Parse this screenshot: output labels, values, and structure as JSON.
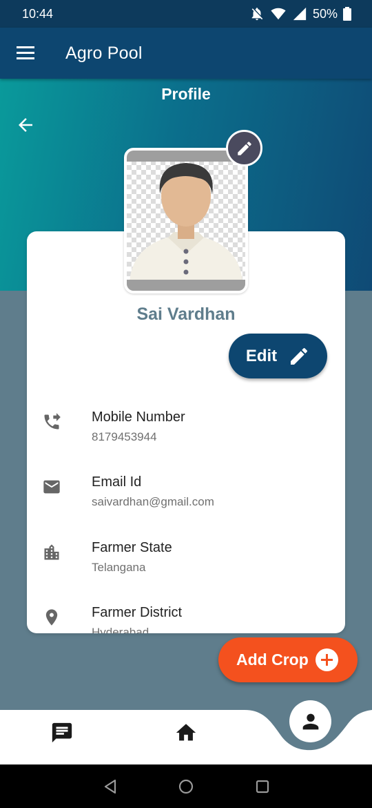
{
  "status_bar": {
    "time": "10:44",
    "battery": "50%"
  },
  "app_bar": {
    "title": "Agro Pool",
    "menu_icon": "menu-icon"
  },
  "page": {
    "title": "Profile"
  },
  "profile": {
    "name": "Sai Vardhan",
    "edit_label": "Edit",
    "fields": [
      {
        "icon": "phone-forward-icon",
        "label": "Mobile Number",
        "value": "8179453944"
      },
      {
        "icon": "email-icon",
        "label": "Email Id",
        "value": "saivardhan@gmail.com"
      },
      {
        "icon": "building-icon",
        "label": "Farmer State",
        "value": "Telangana"
      },
      {
        "icon": "location-pin-icon",
        "label": "Farmer District",
        "value": "Hyderabad"
      }
    ]
  },
  "add_crop": {
    "label": "Add Crop"
  },
  "colors": {
    "primary": "#0d4670",
    "accent": "#f4511e",
    "background": "#5f7d8c"
  }
}
